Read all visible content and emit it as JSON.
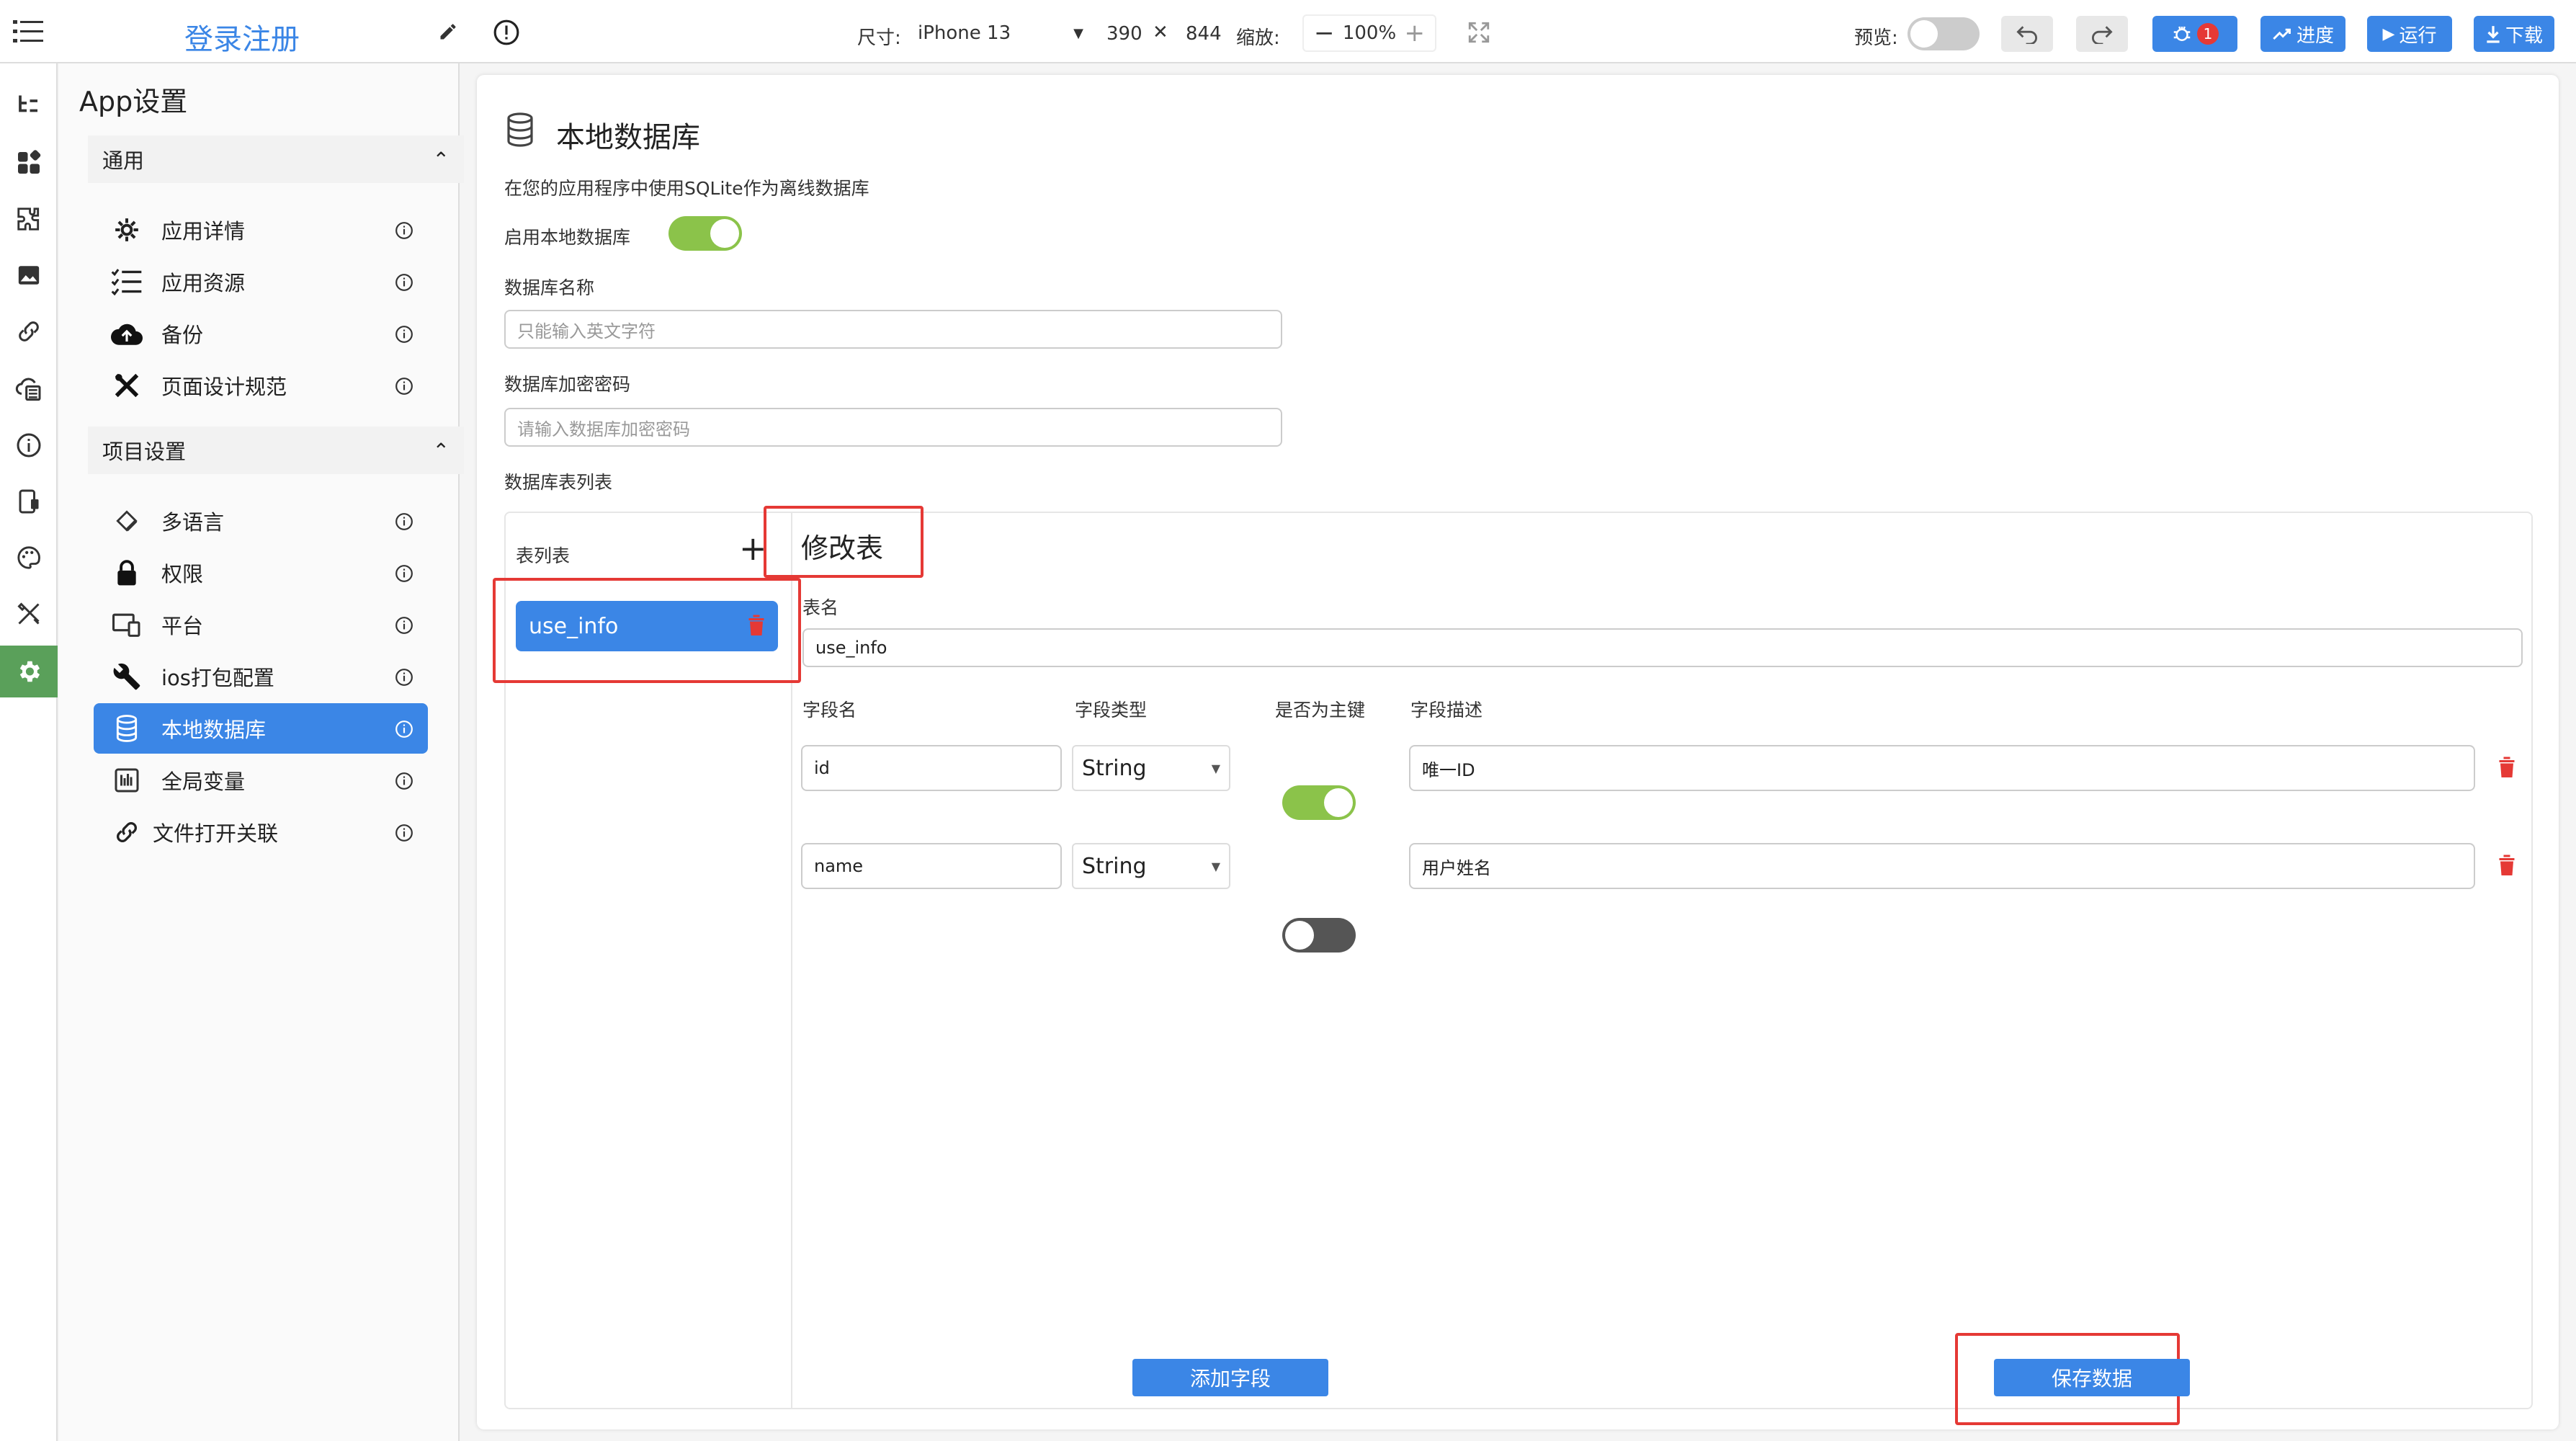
{
  "topbar": {
    "title": "登录注册",
    "size_label": "尺寸:",
    "device": "iPhone 13",
    "width": "390",
    "times": "✕",
    "height": "844",
    "zoom_label": "缩放:",
    "zoom_value": "100%",
    "preview_label": "预览:",
    "debug_badge": "1",
    "progress_label": "进度",
    "run_label": "运行",
    "download_label": "下载"
  },
  "settings": {
    "title": "App设置",
    "general_header": "通用",
    "general_items": [
      "应用详情",
      "应用资源",
      "备份",
      "页面设计规范"
    ],
    "project_header": "项目设置",
    "project_items": [
      "多语言",
      "权限",
      "平台",
      "ios打包配置",
      "本地数据库",
      "全局变量",
      "文件打开关联"
    ]
  },
  "main": {
    "title": "本地数据库",
    "description": "在您的应用程序中使用SQLite作为离线数据库",
    "enable_label": "启用本地数据库",
    "enabled": true,
    "db_name_label": "数据库名称",
    "db_name_placeholder": "只能输入英文字符",
    "db_password_label": "数据库加密密码",
    "db_password_placeholder": "请输入数据库加密密码",
    "table_list_label": "数据库表列表",
    "table_list_header": "表列表",
    "tables": [
      "use_info"
    ],
    "edit_title": "修改表",
    "table_name_label": "表名",
    "table_name_value": "use_info",
    "columns": {
      "field_name": "字段名",
      "field_type": "字段类型",
      "primary_key": "是否为主键",
      "field_desc": "字段描述"
    },
    "fields": [
      {
        "name": "id",
        "type": "String",
        "primary": true,
        "desc": "唯一ID"
      },
      {
        "name": "name",
        "type": "String",
        "primary": false,
        "desc": "用户姓名"
      }
    ],
    "add_field_label": "添加字段",
    "save_label": "保存数据"
  },
  "colors": {
    "accent": "#3b86e6",
    "toggle_on": "#8bc34a",
    "danger": "#e53935",
    "active_rail": "#5aa05a"
  }
}
